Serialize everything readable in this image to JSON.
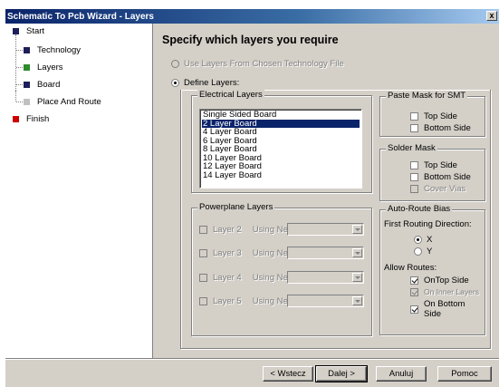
{
  "window": {
    "title": "Schematic To Pcb Wizard - Layers",
    "close_label": "x"
  },
  "steps": [
    {
      "label": "Start",
      "color": "#1e1e5a"
    },
    {
      "label": "Technology",
      "color": "#1e1e5a"
    },
    {
      "label": "Layers",
      "color": "#2e8b2e"
    },
    {
      "label": "Board",
      "color": "#1e1e5a"
    },
    {
      "label": "Place And Route",
      "color": "#c0c0c0"
    },
    {
      "label": "Finish",
      "color": "#cc0000"
    }
  ],
  "heading": "Specify which layers you require",
  "options": {
    "use_technology": "Use Layers From Chosen Technology File",
    "define_layers": "Define Layers:"
  },
  "electrical": {
    "title": "Electrical Layers",
    "items": [
      "Single Sided Board",
      "2 Layer Board",
      "4 Layer Board",
      "6 Layer Board",
      "8 Layer Board",
      "10 Layer Board",
      "12 Layer Board",
      "14 Layer Board"
    ],
    "selected": "2 Layer Board"
  },
  "powerplane": {
    "title": "Powerplane Layers",
    "using_net": "Using Net",
    "layers": [
      "Layer 2",
      "Layer 3",
      "Layer 4",
      "Layer 5"
    ]
  },
  "paste_mask": {
    "title": "Paste Mask for SMT",
    "top": "Top Side",
    "bottom": "Bottom Side"
  },
  "solder_mask": {
    "title": "Solder Mask",
    "top": "Top Side",
    "bottom": "Bottom Side",
    "cover_vias": "Cover Vias"
  },
  "auto_route": {
    "title": "Auto-Route Bias",
    "first_direction": "First Routing Direction:",
    "x": "X",
    "y": "Y",
    "allow_routes": "Allow Routes:",
    "on_top": "OnTop Side",
    "on_inner": "On Inner Layers",
    "on_bottom": "On Bottom Side"
  },
  "buttons": {
    "back": "< Wstecz",
    "next": "Dalej >",
    "cancel": "Anuluj",
    "help": "Pomoc"
  }
}
